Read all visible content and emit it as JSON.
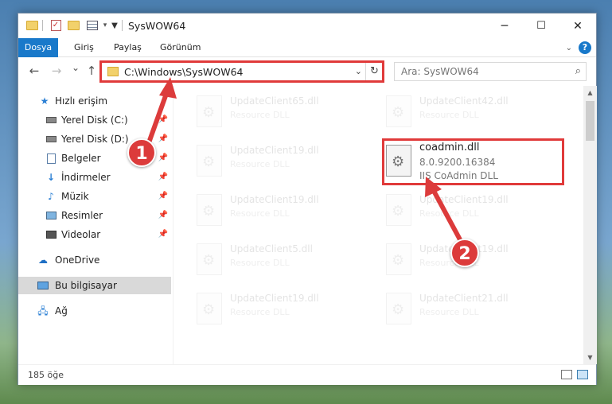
{
  "window": {
    "title": "SysWOW64",
    "minimize_icon": "─",
    "maximize_icon": "☐",
    "close_icon": "✕"
  },
  "ribbon": {
    "tabs": [
      "Dosya",
      "Giriş",
      "Paylaş",
      "Görünüm"
    ],
    "help_label": "?"
  },
  "navigation": {
    "back_icon": "←",
    "forward_icon": "→",
    "recent_icon": "⌄",
    "up_icon": "↑",
    "address": "C:\\Windows\\SysWOW64",
    "search_placeholder": "Ara: SysWOW64"
  },
  "sidebar": {
    "items": [
      {
        "label": "Hızlı erişim",
        "icon": "star-icon",
        "pinned": false
      },
      {
        "label": "Yerel Disk (C:)",
        "icon": "drive-icon",
        "pinned": true
      },
      {
        "label": "Yerel Disk (D:)",
        "icon": "drive-icon",
        "pinned": true
      },
      {
        "label": "Belgeler",
        "icon": "documents-icon",
        "pinned": true
      },
      {
        "label": "İndirmeler",
        "icon": "download-icon",
        "pinned": true
      },
      {
        "label": "Müzik",
        "icon": "music-icon",
        "pinned": true
      },
      {
        "label": "Resimler",
        "icon": "pictures-icon",
        "pinned": true
      },
      {
        "label": "Videolar",
        "icon": "videos-icon",
        "pinned": true
      },
      {
        "label": "OneDrive",
        "icon": "cloud-icon",
        "pinned": false
      },
      {
        "label": "Bu bilgisayar",
        "icon": "computer-icon",
        "pinned": false
      },
      {
        "label": "Ağ",
        "icon": "network-icon",
        "pinned": false
      }
    ]
  },
  "files": [
    {
      "name": "UpdateClient65.dll",
      "desc": "Resource DLL"
    },
    {
      "name": "UpdateClient42.dll",
      "desc": "Resource DLL"
    },
    {
      "name": "UpdateClient19.dll",
      "desc": "Resource DLL"
    },
    {
      "name": "UpdateClient19.dll",
      "desc": "Resource DLL"
    },
    {
      "name": "UpdateClient19.dll",
      "desc": "Resource DLL"
    },
    {
      "name": "UpdateClient5.dll",
      "desc": "Resource DLL"
    },
    {
      "name": "UpdateClient19.dll",
      "desc": "Resource DLL"
    },
    {
      "name": "UpdateClient19.dll",
      "desc": "Resource DLL"
    },
    {
      "name": "UpdateClient21.dll",
      "desc": "Resource DLL"
    }
  ],
  "selected_file": {
    "name": "coadmin.dll",
    "version": "8.0.9200.16384",
    "desc": "IIS CoAdmin DLL"
  },
  "status": {
    "item_count": "185 öğe"
  },
  "annotations": {
    "step1": "1",
    "step2": "2",
    "color": "#dc3b3b"
  }
}
